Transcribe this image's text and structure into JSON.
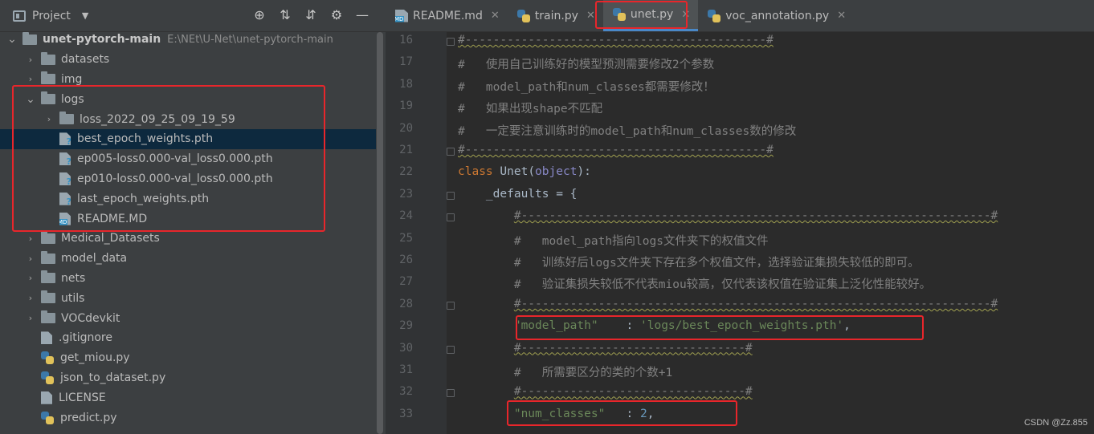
{
  "project_panel": {
    "title": "Project",
    "tree": [
      {
        "name": "unet-pytorch-main",
        "path": "E:\\NEt\\U-Net\\unet-pytorch-main",
        "type": "folder",
        "level": 0,
        "expanded": true
      },
      {
        "name": "datasets",
        "type": "folder",
        "level": 1
      },
      {
        "name": "img",
        "type": "folder",
        "level": 1
      },
      {
        "name": "logs",
        "type": "folder",
        "level": 1,
        "expanded": true
      },
      {
        "name": "loss_2022_09_25_09_19_59",
        "type": "folder",
        "level": 2
      },
      {
        "name": "best_epoch_weights.pth",
        "type": "pth",
        "level": 2,
        "selected": true
      },
      {
        "name": "ep005-loss0.000-val_loss0.000.pth",
        "type": "pth",
        "level": 2
      },
      {
        "name": "ep010-loss0.000-val_loss0.000.pth",
        "type": "pth",
        "level": 2
      },
      {
        "name": "last_epoch_weights.pth",
        "type": "pth",
        "level": 2
      },
      {
        "name": "README.MD",
        "type": "md",
        "level": 2
      },
      {
        "name": "Medical_Datasets",
        "type": "folder",
        "level": 1
      },
      {
        "name": "model_data",
        "type": "folder",
        "level": 1
      },
      {
        "name": "nets",
        "type": "folder",
        "level": 1
      },
      {
        "name": "utils",
        "type": "folder",
        "level": 1
      },
      {
        "name": "VOCdevkit",
        "type": "folder",
        "level": 1
      },
      {
        "name": ".gitignore",
        "type": "git",
        "level": 1
      },
      {
        "name": "get_miou.py",
        "type": "py",
        "level": 1
      },
      {
        "name": "json_to_dataset.py",
        "type": "py",
        "level": 1
      },
      {
        "name": "LICENSE",
        "type": "txt",
        "level": 1
      },
      {
        "name": "predict.py",
        "type": "py",
        "level": 1
      }
    ]
  },
  "tabs": [
    {
      "label": "README.md",
      "icon": "markdown-icon",
      "active": false
    },
    {
      "label": "train.py",
      "icon": "python-icon",
      "active": false
    },
    {
      "label": "unet.py",
      "icon": "python-icon",
      "active": true
    },
    {
      "label": "voc_annotation.py",
      "icon": "python-icon",
      "active": false
    }
  ],
  "editor": {
    "lines": [
      {
        "n": "16",
        "text": "#-------------------------------------------#"
      },
      {
        "n": "17",
        "text": "#   使用自己训练好的模型预测需要修改2个参数"
      },
      {
        "n": "18",
        "text": "#   model_path和num_classes都需要修改！"
      },
      {
        "n": "19",
        "text": "#   如果出现shape不匹配"
      },
      {
        "n": "20",
        "text": "#   一定要注意训练时的model_path和num_classes数的修改"
      },
      {
        "n": "21",
        "text": "#-------------------------------------------#"
      },
      {
        "n": "22",
        "text": "class Unet(object):"
      },
      {
        "n": "23",
        "text": "    _defaults = {"
      },
      {
        "n": "24",
        "text": "        #-------------------------------------------------------------------#"
      },
      {
        "n": "25",
        "text": "        #   model_path指向logs文件夹下的权值文件"
      },
      {
        "n": "26",
        "text": "        #   训练好后logs文件夹下存在多个权值文件，选择验证集损失较低的即可。"
      },
      {
        "n": "27",
        "text": "        #   验证集损失较低不代表miou较高，仅代表该权值在验证集上泛化性能较好。"
      },
      {
        "n": "28",
        "text": "        #-------------------------------------------------------------------#"
      },
      {
        "n": "29",
        "text": "        \"model_path\"    : 'logs/best_epoch_weights.pth',"
      },
      {
        "n": "30",
        "text": "        #--------------------------------#"
      },
      {
        "n": "31",
        "text": "        #   所需要区分的类的个数+1"
      },
      {
        "n": "32",
        "text": "        #--------------------------------#"
      },
      {
        "n": "33",
        "text": "        \"num_classes\"   : 2,"
      }
    ]
  },
  "watermark": "CSDN @Zz.855"
}
